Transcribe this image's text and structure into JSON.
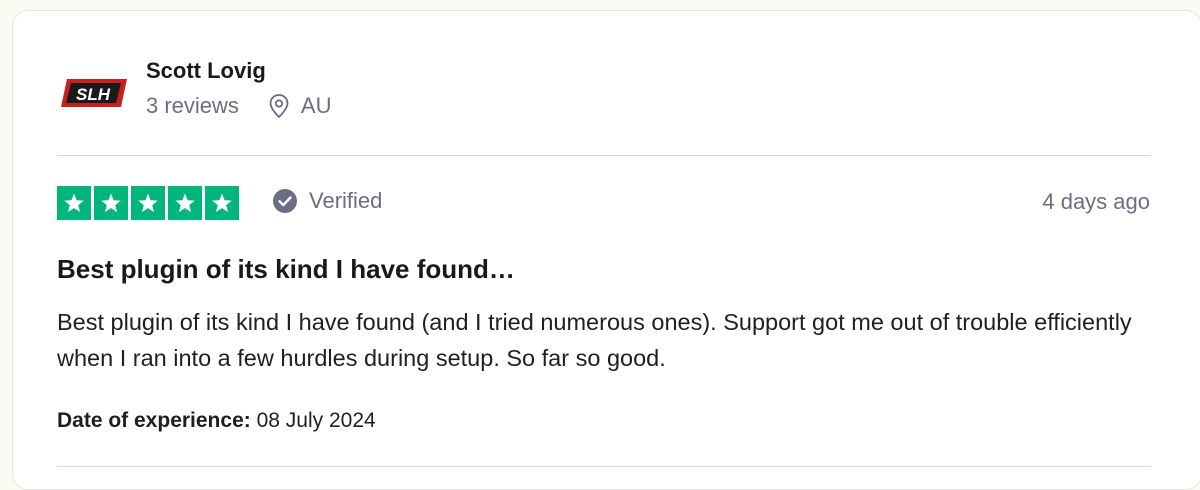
{
  "review": {
    "author": {
      "avatar_text": "SLH",
      "name": "Scott Lovig",
      "reviews_count": "3 reviews",
      "location_icon": "location-pin-icon",
      "location": "AU"
    },
    "rating": {
      "stars": 5,
      "max_stars": 5,
      "star_color": "#00b67a"
    },
    "verified_label": "Verified",
    "date_ago": "4 days ago",
    "title": "Best plugin of its kind I have found…",
    "body": "Best plugin of its kind I have found (and I tried numerous ones). Support got me out of trouble efficiently when I ran into a few hurdles during setup. So far so good.",
    "experience": {
      "label": "Date of experience:",
      "value": "08 July 2024"
    }
  }
}
